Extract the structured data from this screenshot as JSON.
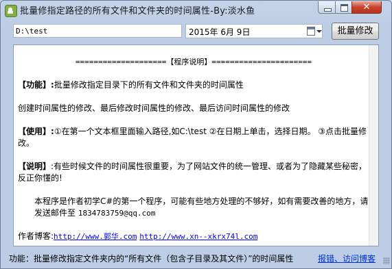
{
  "window": {
    "title": "批量修指定路径的所有文件和文件夹的时间属性-By:淡水鱼",
    "close_glyph": "✕"
  },
  "toolbar": {
    "path_value": "D:\\test",
    "date_value": "2015年  6月  9日",
    "batch_button_label": "批量修改"
  },
  "content": {
    "heading": "====================【程序说明】======================",
    "function_label": "【功能】:",
    "function_text": "批量修改指定目录下的所有文件和文件夹的时间属性",
    "attributes_text": "创建时间属性的修改、最后修改时间属性的修改、最后访问时间属性的修改",
    "usage_label": "【使用】:",
    "usage_text": "①在第一个文本框里面输入路径,如C:\\test ②在日期上单击，选择日期。 ③点击批量修改。",
    "note_label": "【说明】",
    "note_text": ":有些时候文件的时间属性很重要，为了网站文件的统一管理、或者为了隐藏某些秘密，反正你懂的!",
    "author_text": "本程序是作者初学C#的第一个程序，可能有些地方处理的不够好，如有需要改善的地方，请发送邮件至",
    "email": "1834783759@qq.com",
    "blog_label": "作者博客:",
    "blog_link1": "http://www.郭华.com",
    "blog_link2": "http://www.xn--xkrx74l.com"
  },
  "statusbar": {
    "text": "功能：批量修改指定文件夹内的“所有文件（包含子目录及其文件）”的时间属性",
    "link": "报错、访问博客"
  }
}
